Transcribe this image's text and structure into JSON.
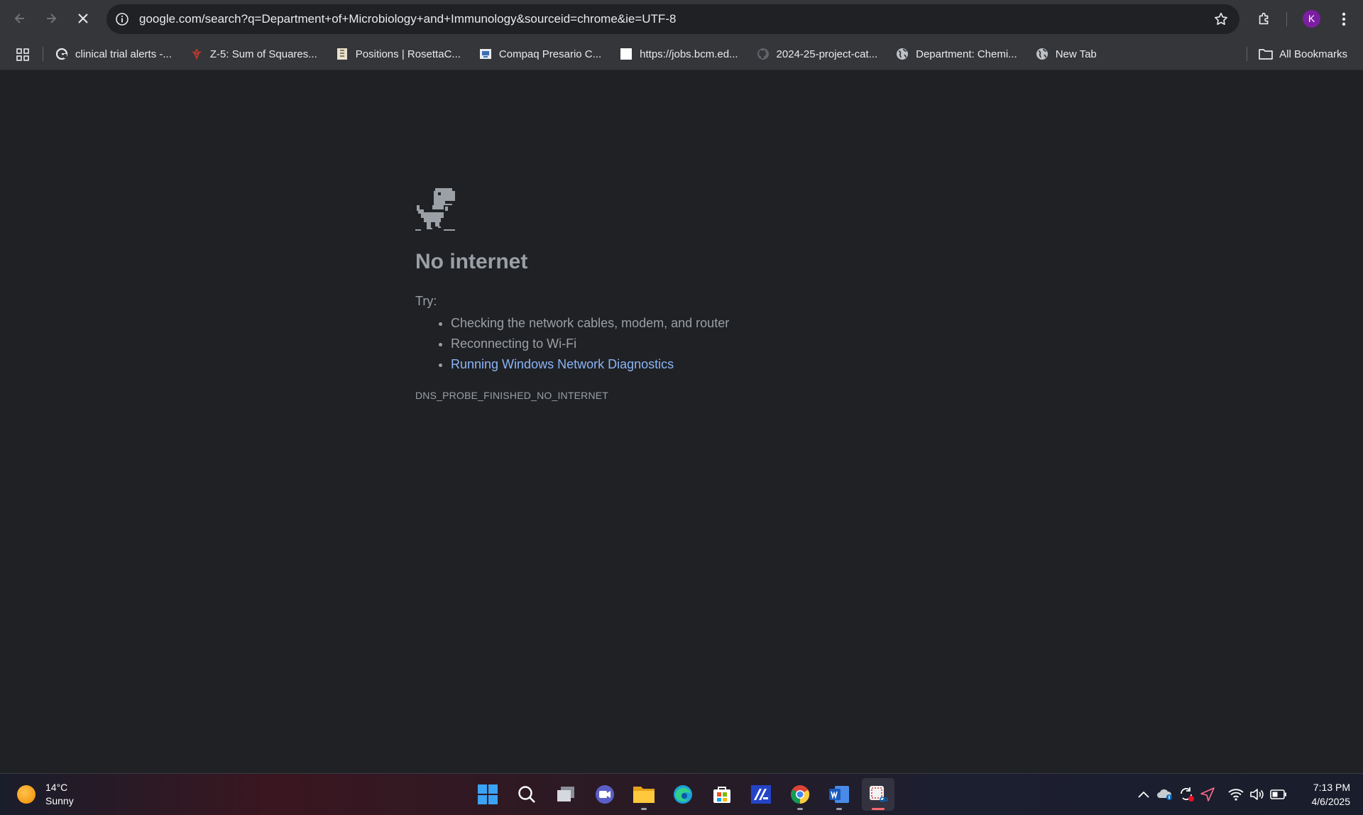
{
  "browser": {
    "url": "google.com/search?q=Department+of+Microbiology+and+Immunology&sourceid=chrome&ie=UTF-8",
    "profile_initial": "K"
  },
  "bookmarks": {
    "items": [
      {
        "label": "clinical trial alerts -...",
        "icon": "google-g-icon"
      },
      {
        "label": "Z-5: Sum of Squares...",
        "icon": "red-figure-icon"
      },
      {
        "label": "Positions | RosettaC...",
        "icon": "rosetta-icon"
      },
      {
        "label": "Compaq Presario C...",
        "icon": "document-icon"
      },
      {
        "label": "https://jobs.bcm.ed...",
        "icon": "blank-page-icon"
      },
      {
        "label": "2024-25-project-cat...",
        "icon": "github-icon"
      },
      {
        "label": "Department: Chemi...",
        "icon": "globe-icon"
      },
      {
        "label": "New Tab",
        "icon": "globe-icon"
      }
    ],
    "all_label": "All Bookmarks"
  },
  "error": {
    "title": "No internet",
    "try_label": "Try:",
    "suggestions": [
      "Checking the network cables, modem, and router",
      "Reconnecting to Wi-Fi",
      "Running Windows Network Diagnostics"
    ],
    "code": "DNS_PROBE_FINISHED_NO_INTERNET"
  },
  "taskbar": {
    "weather_temp": "14°C",
    "weather_condition": "Sunny",
    "time": "7:13 PM",
    "date": "4/6/2025",
    "apps": [
      "windows-start-icon",
      "search-icon",
      "task-view-icon",
      "meet-icon",
      "file-explorer-icon",
      "edge-icon",
      "store-icon",
      "app-icon",
      "chrome-icon",
      "word-icon",
      "snipping-tool-icon"
    ]
  },
  "colors": {
    "page_bg": "#202124",
    "toolbar_bg": "#35363a",
    "link": "#8ab4f8",
    "text_muted": "#9aa0a6",
    "avatar": "#7b1fa2"
  }
}
